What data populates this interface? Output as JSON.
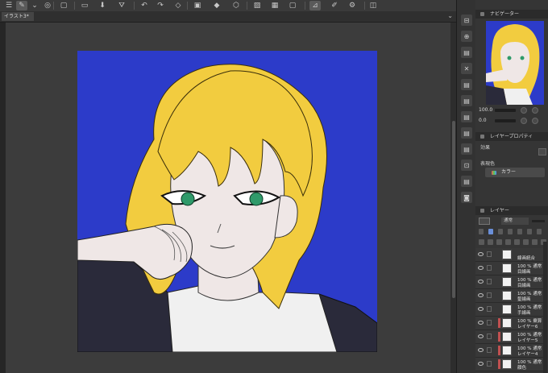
{
  "toolbar": {
    "icons": [
      "menu-icon",
      "pen-tool-icon",
      "chevron-down-icon",
      "camera-icon",
      "new-file-icon",
      "open-folder-icon",
      "save-icon",
      "bucket-fill-icon",
      "undo-icon",
      "redo-icon",
      "erase-icon",
      "clear-icon",
      "fill-icon",
      "transform-icon",
      "deselect-icon",
      "invert-icon",
      "show-selection-icon",
      "ruler-icon",
      "brush-icon",
      "settings-icon",
      "layer-icon"
    ],
    "glyphs": [
      "☰",
      "✎",
      "⌄",
      "◎",
      "▢",
      "▭",
      "⬇",
      "⛛",
      "↶",
      "↷",
      "◇",
      "▣",
      "◆",
      "⬡",
      "▨",
      "▦",
      "▢",
      "⊿",
      "✐",
      "⚙",
      "◫"
    ]
  },
  "tabbar": {
    "tab_label": "イラスト3*",
    "arrow": "⌄"
  },
  "canvas": {
    "background": "#2c3bc9",
    "hair": "#f2cc3f",
    "skin": "#efe7e6",
    "shirt": "#f0f0f0",
    "jacket": "#2a2a3a",
    "eye": "#2f9a6a"
  },
  "side_icons": {
    "glyphs": [
      "⊟",
      "⊕",
      "▤",
      "✕",
      "▤",
      "▤",
      "▤",
      "▤",
      "▤",
      "⊡",
      "▤",
      "◙"
    ],
    "names": [
      "collapse-icon",
      "zoom-icon",
      "material-icon",
      "close-icon",
      "material-icon-2",
      "material-icon-3",
      "material-icon-4",
      "material-icon-5",
      "material-icon-6",
      "export-icon",
      "material-icon-7",
      "camera-panel-icon"
    ]
  },
  "navigator": {
    "title": "ナビゲーター",
    "zoom_value": "100.0",
    "rotation_value": "0.0"
  },
  "layer_property": {
    "title": "レイヤープロパティ",
    "effect_label": "効果",
    "expression_color_label": "表現色",
    "expression_color_value": "カラー"
  },
  "layers": {
    "title": "レイヤー",
    "blend_mode": "通常",
    "items": [
      {
        "l1": "",
        "l2": "線画統合",
        "mark": false
      },
      {
        "l1": "100 % 通常",
        "l2": "目線画",
        "mark": false
      },
      {
        "l1": "100 % 通常",
        "l2": "目線画",
        "mark": false
      },
      {
        "l1": "100 % 通常",
        "l2": "髪線画",
        "mark": false
      },
      {
        "l1": "100 % 通常",
        "l2": "手線画",
        "mark": false
      },
      {
        "l1": "100 % 乗算",
        "l2": "レイヤー6",
        "mark": true
      },
      {
        "l1": "100 % 通常",
        "l2": "レイヤー5",
        "mark": true
      },
      {
        "l1": "100 % 通常",
        "l2": "レイヤー4",
        "mark": true
      },
      {
        "l1": "100 % 通常",
        "l2": "顔色",
        "mark": true
      }
    ]
  }
}
